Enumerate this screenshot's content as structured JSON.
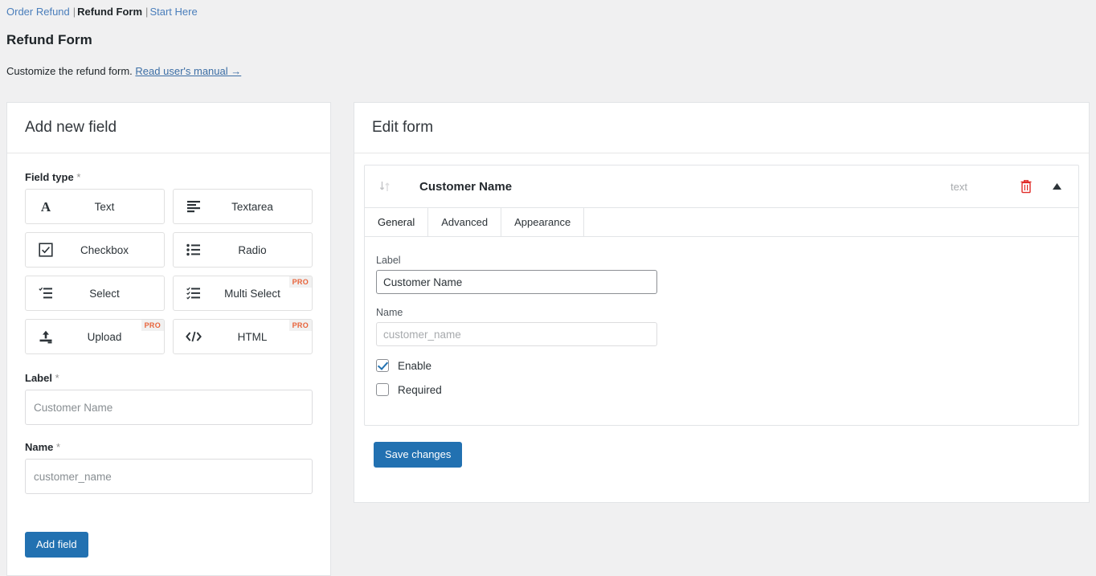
{
  "breadcrumb": {
    "items": [
      {
        "label": "Order Refund",
        "link": true,
        "current": false
      },
      {
        "label": "Refund Form",
        "link": false,
        "current": true
      },
      {
        "label": "Start Here",
        "link": true,
        "current": false
      }
    ],
    "separator": "|"
  },
  "page": {
    "title": "Refund Form",
    "description": "Customize the refund form.",
    "manual_link": "Read user's manual →"
  },
  "left_panel": {
    "header": "Add new field",
    "field_type_label": "Field type",
    "required_star": "*",
    "field_types": [
      {
        "label": "Text",
        "icon": "letter-a-icon",
        "pro": false,
        "pro_label": "PRO"
      },
      {
        "label": "Textarea",
        "icon": "align-left-icon",
        "pro": false,
        "pro_label": "PRO"
      },
      {
        "label": "Checkbox",
        "icon": "checkbox-icon",
        "pro": false,
        "pro_label": "PRO"
      },
      {
        "label": "Radio",
        "icon": "bullet-list-icon",
        "pro": false,
        "pro_label": "PRO"
      },
      {
        "label": "Select",
        "icon": "select-list-icon",
        "pro": false,
        "pro_label": "PRO"
      },
      {
        "label": "Multi Select",
        "icon": "checklist-icon",
        "pro": true,
        "pro_label": "PRO"
      },
      {
        "label": "Upload",
        "icon": "upload-icon",
        "pro": true,
        "pro_label": "PRO"
      },
      {
        "label": "HTML",
        "icon": "code-icon",
        "pro": true,
        "pro_label": "PRO"
      }
    ],
    "label_field": {
      "label": "Label",
      "value": "",
      "placeholder": "Customer Name"
    },
    "name_field": {
      "label": "Name",
      "value": "",
      "placeholder": "customer_name"
    },
    "add_button": "Add field"
  },
  "right_panel": {
    "header": "Edit form",
    "field": {
      "title": "Customer Name",
      "type": "text",
      "drag_icon": "sort-handle-icon",
      "delete_icon": "trash-icon",
      "collapse_icon": "caret-up-icon"
    },
    "tabs": [
      {
        "label": "General",
        "active": true
      },
      {
        "label": "Advanced",
        "active": false
      },
      {
        "label": "Appearance",
        "active": false
      }
    ],
    "general": {
      "label_field": {
        "label": "Label",
        "value": "Customer Name",
        "placeholder": ""
      },
      "name_field": {
        "label": "Name",
        "value": "",
        "placeholder": "customer_name"
      },
      "checkboxes": [
        {
          "label": "Enable",
          "checked": true
        },
        {
          "label": "Required",
          "checked": false
        }
      ]
    },
    "save_button": "Save changes"
  },
  "colors": {
    "accent": "#2271b1",
    "link": "#4a7ebb",
    "pro_badge": "#e8633a",
    "danger": "#e02b27",
    "page_bg": "#f0f0f1"
  }
}
